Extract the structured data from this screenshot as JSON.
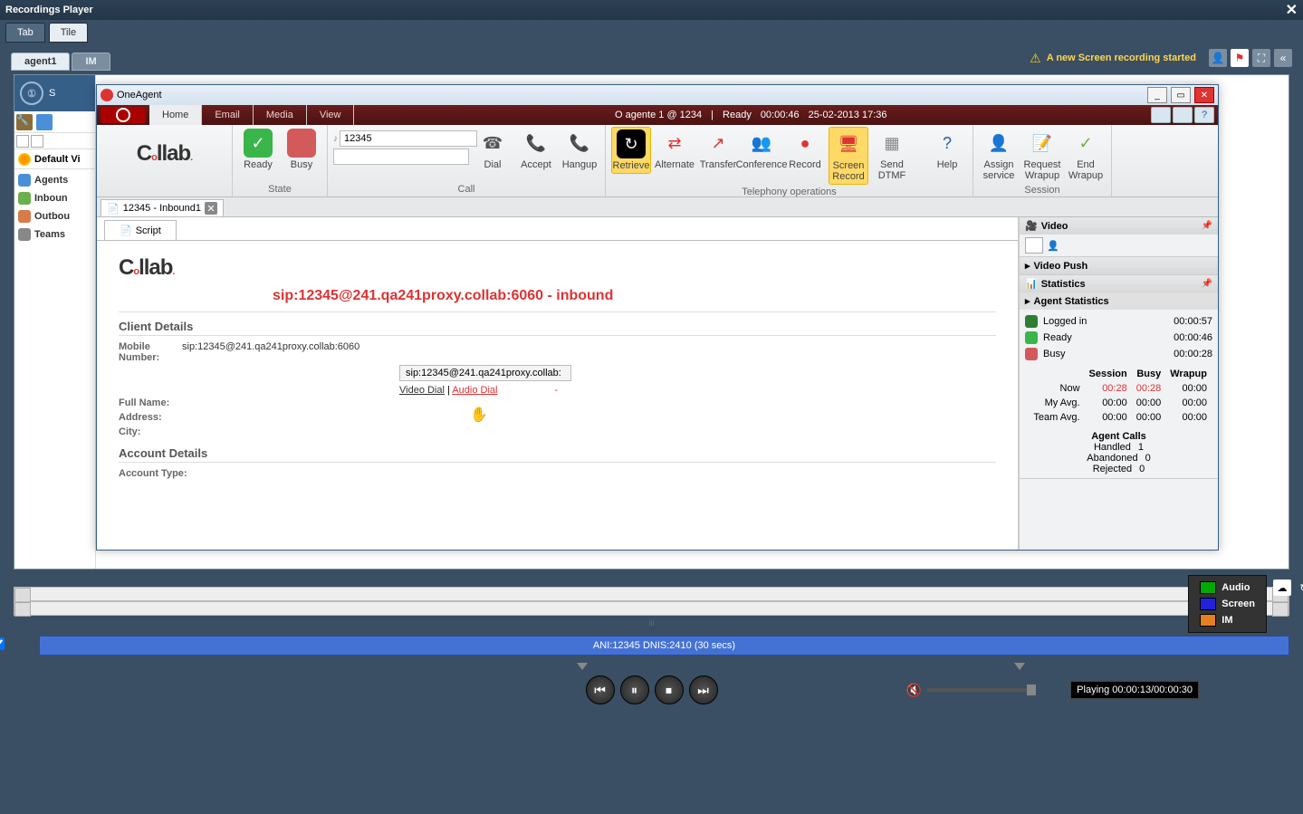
{
  "window_title": "Recordings Player",
  "layout_tabs": {
    "tab": "Tab",
    "tile": "Tile"
  },
  "main_tabs": {
    "agent1": "agent1",
    "im": "IM"
  },
  "notification": "A new Screen recording started",
  "left_panel": {
    "default_view": "Default Vi",
    "items": [
      "Agents",
      "Inboun",
      "Outbou",
      "Teams"
    ]
  },
  "one_agent": {
    "title": "OneAgent",
    "menu": {
      "home": "Home",
      "email": "Email",
      "media": "Media",
      "view": "View"
    },
    "status": {
      "agent": "O agente 1 @ 1234",
      "state": "Ready",
      "timer": "00:00:46",
      "datetime": "25-02-2013 17:36"
    },
    "ribbon": {
      "state": {
        "label": "State",
        "ready": "Ready",
        "busy": "Busy"
      },
      "call": {
        "label": "Call",
        "field_icon": "♪",
        "field_value": "12345",
        "dial": "Dial",
        "accept": "Accept",
        "hangup": "Hangup"
      },
      "tel": {
        "label": "Telephony operations",
        "retrieve": "Retrieve",
        "alternate": "Alternate",
        "transfer": "Transfer",
        "conference": "Conference",
        "record": "Record",
        "screen": "Screen\nRecord",
        "dtmf": "Send\nDTMF",
        "help": "Help"
      },
      "session": {
        "label": "Session",
        "assign": "Assign\nservice",
        "request": "Request\nWrapup",
        "end": "End\nWrapup"
      }
    },
    "doc_tab": "12345 - Inbound1",
    "sub_tab": "Script",
    "script": {
      "logo": "Collab.",
      "sip_line": "sip:12345@241.qa241proxy.collab:6060 - inbound",
      "client_details": "Client Details",
      "mobile_label": "Mobile Number:",
      "mobile_value": "sip:12345@241.qa241proxy.collab:6060",
      "sip_box": "sip:12345@241.qa241proxy.collab:",
      "video_dial": "Video Dial",
      "audio_dial": "Audio Dial",
      "sep": " | ",
      "dash": "-",
      "full_name": "Full Name:",
      "address": "Address:",
      "city": "City:",
      "account_details": "Account Details",
      "account_type": "Account Type:"
    },
    "sidebar": {
      "video": "Video",
      "video_push": "Video Push",
      "statistics": "Statistics",
      "agent_stats": "Agent Statistics",
      "logged_in": {
        "label": "Logged in",
        "value": "00:00:57"
      },
      "ready": {
        "label": "Ready",
        "value": "00:00:46"
      },
      "busy": {
        "label": "Busy",
        "value": "00:00:28"
      },
      "hdr": {
        "session": "Session",
        "busy": "Busy",
        "wrapup": "Wrapup"
      },
      "rows": {
        "now": {
          "l": "Now",
          "s": "00:28",
          "b": "00:28",
          "w": "00:00"
        },
        "myavg": {
          "l": "My Avg.",
          "s": "00:00",
          "b": "00:00",
          "w": "00:00"
        },
        "teamavg": {
          "l": "Team Avg.",
          "s": "00:00",
          "b": "00:00",
          "w": "00:00"
        }
      },
      "calls": {
        "title": "Agent Calls",
        "handled": "Handled",
        "handled_v": "1",
        "abandoned": "Abandoned",
        "abandoned_v": "0",
        "rejected": "Rejected",
        "rejected_v": "0"
      }
    }
  },
  "playback": {
    "track": "ANI:12345 DNIS:2410 (30 secs)",
    "legend": {
      "audio": "Audio",
      "screen": "Screen",
      "im": "IM"
    },
    "time": "Playing 00:00:13/00:00:30"
  }
}
